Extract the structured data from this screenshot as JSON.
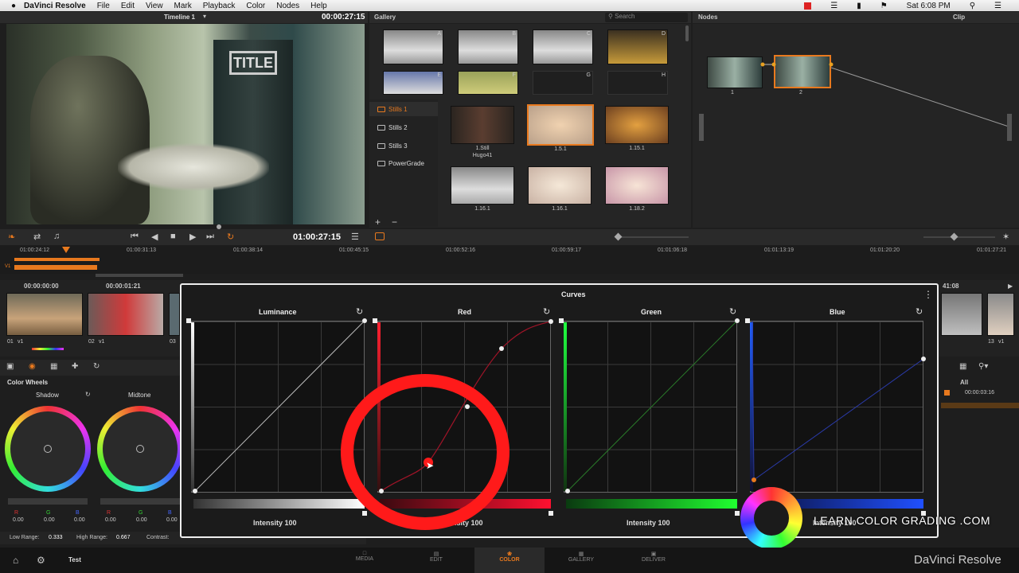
{
  "menubar": {
    "app": "DaVinci Resolve",
    "items": [
      "File",
      "Edit",
      "View",
      "Mark",
      "Playback",
      "Color",
      "Nodes",
      "Help"
    ],
    "clock": "Sat 6:08 PM"
  },
  "viewer": {
    "timeline": "Timeline 1",
    "timecode": "00:00:27:15",
    "playhead_tc": "01:00:27:15"
  },
  "gallery": {
    "title": "Gallery",
    "search_placeholder": "Search",
    "stills_top": [
      "A",
      "B",
      "C",
      "D",
      "E",
      "F",
      "G",
      "H"
    ],
    "albums": [
      "Stills 1",
      "Stills 2",
      "Stills 3",
      "PowerGrade"
    ],
    "stills": [
      {
        "l": "1.Still",
        "s": "Hugo41"
      },
      {
        "l": "1.5.1",
        "s": ""
      },
      {
        "l": "1.15.1",
        "s": ""
      },
      {
        "l": "1.16.1",
        "s": ""
      },
      {
        "l": "1.16.1",
        "s": ""
      },
      {
        "l": "1.18.2",
        "s": ""
      }
    ]
  },
  "nodes": {
    "title": "Nodes",
    "clip": "Clip",
    "n1": "1",
    "n2": "2"
  },
  "timeline": {
    "ticks": [
      "01:00:24:12",
      "01:00:31:13",
      "01:00:38:14",
      "01:00:45:15",
      "01:00:52:16",
      "01:00:59:17",
      "01:01:06:18",
      "01:01:13:19",
      "01:01:20:20",
      "01:01:27:21"
    ],
    "track": "V1"
  },
  "clips": {
    "tc1": "00:00:00:00",
    "tc2": "00:00:01:21",
    "c1": "01",
    "v1": "v1",
    "c2": "02",
    "v2": "v1",
    "c3": "03",
    "tc_right": "41:08",
    "c13": "13",
    "v13": "v1",
    "all": "All",
    "tc_side": "00:00:03:16"
  },
  "colorwheels": {
    "title": "Color Wheels",
    "shadow": "Shadow",
    "midtone": "Midtone",
    "r": "R",
    "g": "G",
    "b": "B",
    "v": "0.00",
    "low_range": "Low Range:",
    "low_val": "0.333",
    "high_range": "High Range:",
    "high_val": "0.667",
    "contrast": "Contrast:"
  },
  "curves": {
    "title": "Curves",
    "panels": [
      "Luminance",
      "Red",
      "Green",
      "Blue"
    ],
    "intensity": "Intensity",
    "iv": "100"
  },
  "watermark": "LEARN COLOR GRADING .COM",
  "pages": [
    "MEDIA",
    "EDIT",
    "COLOR",
    "GALLERY",
    "DELIVER"
  ],
  "project": "Test",
  "brand": "DaVinci Resolve",
  "colors": {
    "accent": "#e8791e",
    "highlight": "#ff1a1a"
  }
}
